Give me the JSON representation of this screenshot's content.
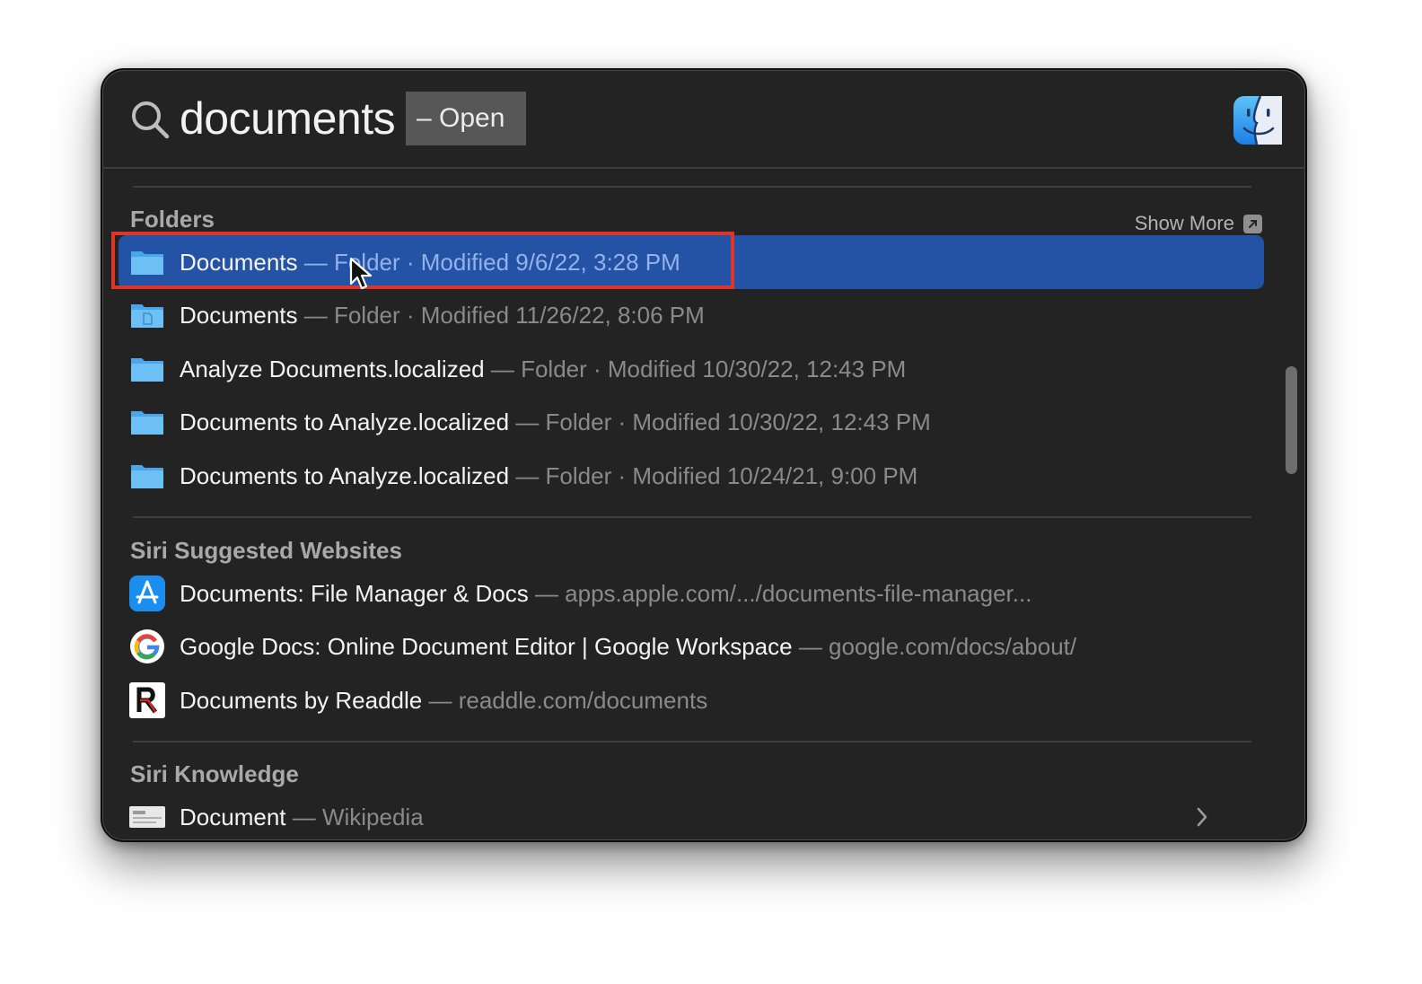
{
  "search": {
    "query": "documents",
    "action_hint": "– Open"
  },
  "folders": {
    "title": "Folders",
    "show_more": "Show More",
    "items": [
      {
        "title": "Documents",
        "sub": " — Folder · Modified 9/6/22, 3:28 PM",
        "selected": true
      },
      {
        "title": "Documents",
        "sub": " — Folder · Modified 11/26/22, 8:06 PM"
      },
      {
        "title": "Analyze Documents.localized",
        "sub": " — Folder · Modified 10/30/22, 12:43 PM"
      },
      {
        "title": "Documents to Analyze.localized",
        "sub": " — Folder · Modified 10/30/22, 12:43 PM"
      },
      {
        "title": "Documents to Analyze.localized",
        "sub": " — Folder · Modified 10/24/21, 9:00 PM"
      }
    ]
  },
  "websites": {
    "title": "Siri Suggested Websites",
    "items": [
      {
        "title": "Documents: File Manager & Docs",
        "sub": " — apps.apple.com/.../documents-file-manager...",
        "icon": "app-store-icon"
      },
      {
        "title": "Google Docs: Online Document Editor | Google Workspace",
        "sub": " — google.com/docs/about/",
        "icon": "google-icon"
      },
      {
        "title": "Documents by Readdle",
        "sub": " — readdle.com/documents",
        "icon": "readdle-icon"
      }
    ]
  },
  "knowledge": {
    "title": "Siri Knowledge",
    "items": [
      {
        "title": "Document",
        "sub": " — Wikipedia",
        "icon": "wikipedia-icon"
      }
    ]
  },
  "colors": {
    "selection": "#2453a6",
    "highlight_box": "#e0342a",
    "panel": "#232323"
  }
}
